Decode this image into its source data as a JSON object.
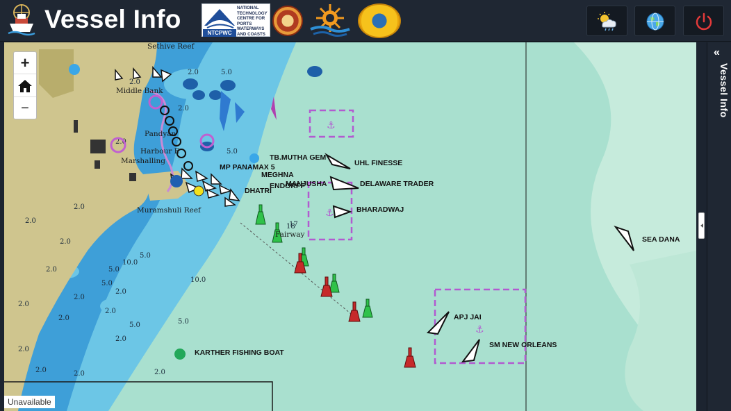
{
  "header": {
    "title": "Vessel Info",
    "ntcpwc_abbr": "NTCPWC",
    "ntcpwc_name": "NATIONAL TECHNOLOGY CENTRE FOR PORTS WATERWAYS AND COASTS",
    "weather_icon": "weather-cloud-sun-icon",
    "globe_icon": "globe-icon",
    "power_icon": "power-icon"
  },
  "map": {
    "zoom_in": "+",
    "zoom_out": "−",
    "status": "Unavailable",
    "places": [
      "Sethive Reef",
      "Middle Bank",
      "Pandyan",
      "Harbour E",
      "Marshalling",
      "Muramshuli Reef",
      "Fairway"
    ],
    "vessels": [
      {
        "name": "TB.MUTHA GEM"
      },
      {
        "name": "UHL FINESSE"
      },
      {
        "name": "DELAWARE TRADER"
      },
      {
        "name": "BHARADWAJ"
      },
      {
        "name": "SEA DANA"
      },
      {
        "name": "APJ JAI"
      },
      {
        "name": "SM NEW ORLEANS"
      },
      {
        "name": "KARTHER FISHING BOAT"
      },
      {
        "name": "MP PANAMAX 5"
      },
      {
        "name": "MEGHNA"
      },
      {
        "name": "MANJUSHA"
      },
      {
        "name": "ENDORFF"
      },
      {
        "name": "DHATRI"
      }
    ]
  },
  "side_panel": {
    "title": "Vessel Info",
    "chevron": "«"
  },
  "colors": {
    "header_bg": "#1f2733",
    "sea_shallow": "#3e9fd8",
    "sea_mid": "#6cc6e6",
    "sea_open": "#a9e0cf",
    "land": "#cfc58e",
    "anchorage": "#b25ad0",
    "power_red": "#e23a3a"
  }
}
